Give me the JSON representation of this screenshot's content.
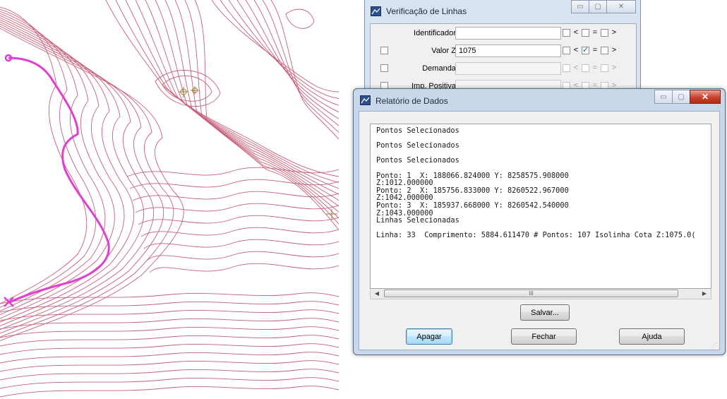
{
  "map": {
    "contour_color": "#c6607a",
    "highlight_color": "#e03fd0",
    "marker_color": "#a07a3a"
  },
  "verificacao": {
    "title": "Verificação de Linhas",
    "rows": [
      {
        "label": "Identificador:",
        "value": "",
        "enabled": true,
        "has_check": false,
        "checks": [
          false,
          false,
          false
        ]
      },
      {
        "label": "Valor Z:",
        "value": "1075",
        "enabled": true,
        "has_check": true,
        "checks": [
          false,
          true,
          false
        ]
      },
      {
        "label": "Demanda:",
        "value": "",
        "enabled": false,
        "has_check": true,
        "checks": [
          false,
          false,
          false
        ]
      },
      {
        "label": "Imp. Positiva:",
        "value": "",
        "enabled": false,
        "has_check": true,
        "checks": [
          false,
          false,
          false
        ]
      }
    ],
    "compare": {
      "lt": "<",
      "eq": "=",
      "gt": ">"
    }
  },
  "relatorio": {
    "title": "Relatório de Dados",
    "report_lines": [
      "Pontos Selecionados",
      "",
      "Pontos Selecionados",
      "",
      "Pontos Selecionados",
      "",
      "Ponto: 1  X: 188066.824000 Y: 8258575.908000",
      "Z:1012.000000",
      "Ponto: 2  X: 185756.833000 Y: 8260522.967000",
      "Z:1042.000000",
      "Ponto: 3  X: 185937.668000 Y: 8260542.540000",
      "Z:1043.000000",
      "Linhas Selecionadas",
      "",
      "Linha: 33  Comprimento: 5884.611470 # Pontos: 107 Isolinha Cota Z:1075.0("
    ],
    "scroll_grip": "III",
    "save_label": "Salvar...",
    "clear_label": "Apagar",
    "close_label": "Fechar",
    "help_label": "Ajuda",
    "close_icon": "x-icon"
  }
}
